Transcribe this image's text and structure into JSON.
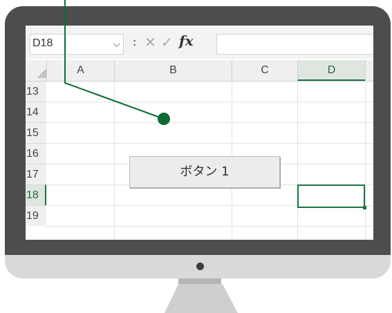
{
  "formula_bar": {
    "name_box": "D18",
    "name_box_arrow_icon": "chevron-down-icon",
    "separator": ":",
    "cancel_glyph": "✕",
    "enter_glyph": "✓",
    "fx_label": "fx",
    "formula_value": ""
  },
  "columns": [
    "A",
    "B",
    "C",
    "D"
  ],
  "selected_column": "D",
  "rows": [
    "13",
    "14",
    "15",
    "16",
    "17",
    "18",
    "19"
  ],
  "selected_row": "18",
  "form_button": {
    "label": "ボタン 1"
  },
  "colors": {
    "accent_green": "#1e7145",
    "callout_green": "#0e6b35",
    "bezel": "#4d4d4d",
    "chin": "#d9d9d9"
  }
}
